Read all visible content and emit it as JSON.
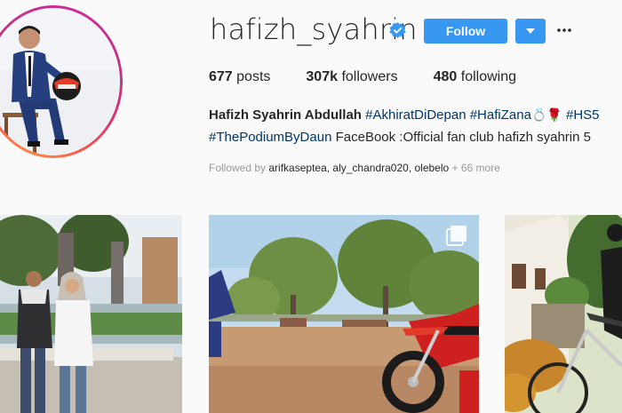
{
  "profile": {
    "username": "hafizh_syahrin",
    "verified": true,
    "follow_label": "Follow",
    "stats": {
      "posts_count": "677",
      "posts_label": "posts",
      "followers_count": "307k",
      "followers_label": "followers",
      "following_count": "480",
      "following_label": "following"
    },
    "bio": {
      "full_name": "Hafizh Syahrin Abdullah",
      "tag1": "#AkhiratDiDepan",
      "tag2": "#HafiZana",
      "emoji_ring": "💍",
      "emoji_rose": "🌹",
      "tag3": "#HS5",
      "tag4": "#ThePodiumByDaun",
      "line2_text": "FaceBook :Official fan club hafizh syahrin 5"
    },
    "followed_by": {
      "prefix": "Followed by",
      "users": "arifkaseptea, aly_chandra020, olebelo",
      "more": "+ 66 more"
    }
  },
  "icons": {
    "verified": "verified-badge-icon",
    "dropdown": "caret-down-icon",
    "more": "ellipsis-icon",
    "multi": "multiple-photos-icon"
  },
  "colors": {
    "accent": "#3897f0",
    "hashtag": "#003569",
    "muted": "#999999",
    "text": "#262626"
  }
}
